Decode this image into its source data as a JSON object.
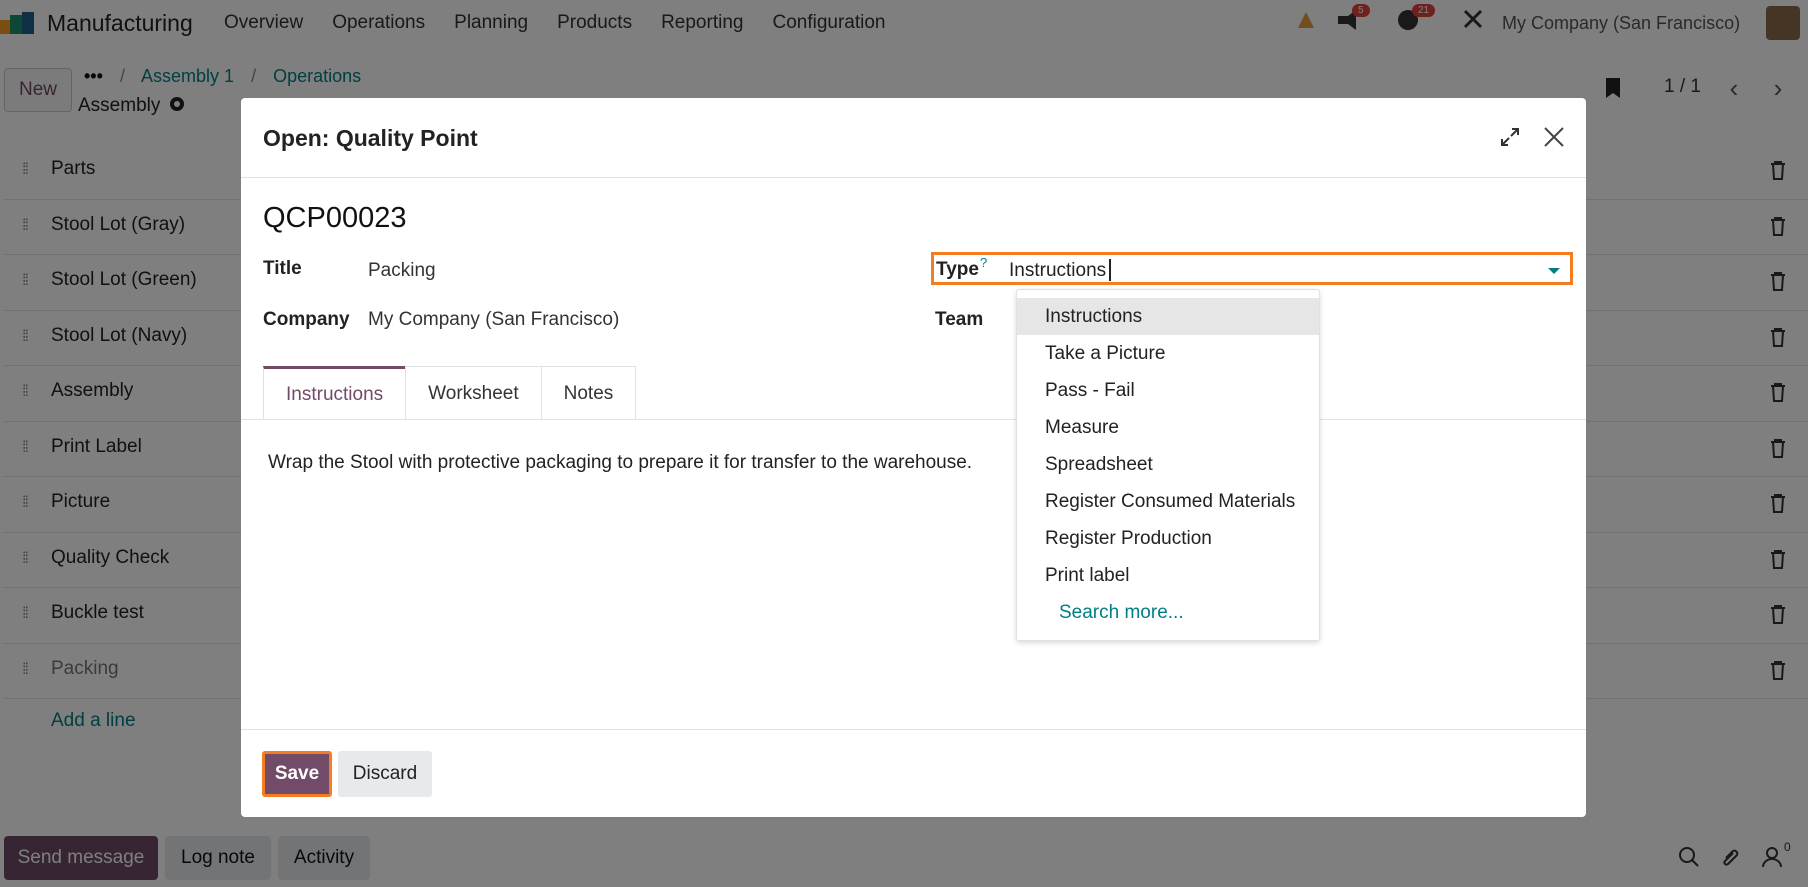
{
  "app": {
    "name": "Manufacturing",
    "menu": [
      "Overview",
      "Operations",
      "Planning",
      "Products",
      "Reporting",
      "Configuration"
    ],
    "company": "My Company (San Francisco)",
    "badges": [
      "5",
      "21"
    ]
  },
  "control": {
    "new_label": "New",
    "breadcrumb": [
      "Assembly 1",
      "Operations"
    ],
    "record_name": "Assembly",
    "pager": "1 / 1"
  },
  "list": {
    "rows": [
      "Parts",
      "Stool Lot (Gray)",
      "Stool Lot (Green)",
      "Stool Lot (Navy)",
      "Assembly",
      "Print Label",
      "Picture",
      "Quality Check",
      "Buckle test",
      "Packing"
    ],
    "add_line": "Add a line"
  },
  "chatter": {
    "send_message": "Send message",
    "log_note": "Log note",
    "activity": "Activity",
    "followers": "0"
  },
  "modal": {
    "title": "Open: Quality Point",
    "reference": "QCP00023",
    "fields": {
      "title_label": "Title",
      "title_value": "Packing",
      "company_label": "Company",
      "company_value": "My Company (San Francisco)",
      "type_label": "Type",
      "type_help": "?",
      "type_value": "Instructions",
      "team_label": "Team"
    },
    "type_options": [
      "Instructions",
      "Take a Picture",
      "Pass - Fail",
      "Measure",
      "Spreadsheet",
      "Register Consumed Materials",
      "Register Production",
      "Print label"
    ],
    "search_more": "Search more...",
    "tabs": [
      "Instructions",
      "Worksheet",
      "Notes"
    ],
    "instruction_text": "Wrap the Stool with protective packaging to prepare it for transfer to the warehouse.",
    "save": "Save",
    "discard": "Discard"
  },
  "colors": {
    "brand": "#714b67",
    "link": "#017e84",
    "highlight": "#f57c20"
  }
}
